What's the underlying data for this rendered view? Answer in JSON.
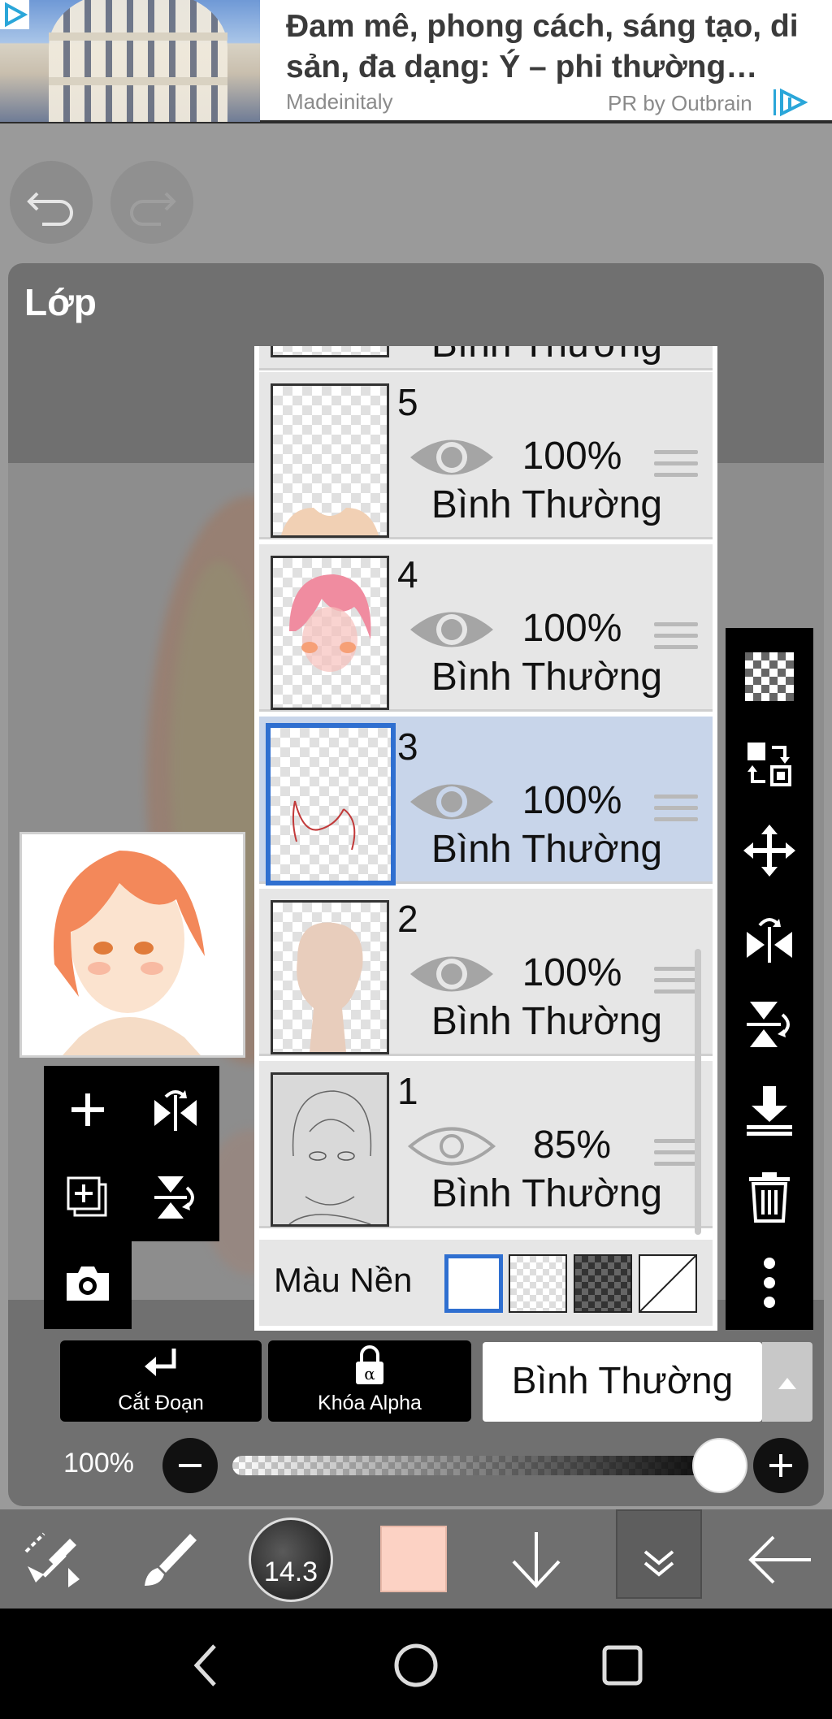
{
  "ad": {
    "title": "Đam mê, phong cách, sáng tạo, di sản, đa dạng: Ý – phi thường…",
    "source": "Madeinitaly",
    "pr": "PR by Outbrain"
  },
  "panel": {
    "title": "Lớp"
  },
  "layers": [
    {
      "number": "5",
      "opacity": "100%",
      "blend": "Bình Thường",
      "visible": true,
      "selected": false
    },
    {
      "number": "4",
      "opacity": "100%",
      "blend": "Bình Thường",
      "visible": true,
      "selected": false
    },
    {
      "number": "3",
      "opacity": "100%",
      "blend": "Bình Thường",
      "visible": true,
      "selected": true
    },
    {
      "number": "2",
      "opacity": "100%",
      "blend": "Bình Thường",
      "visible": true,
      "selected": false
    },
    {
      "number": "1",
      "opacity": "85%",
      "blend": "Bình Thường",
      "visible": true,
      "selected": false
    }
  ],
  "partial_layer_blend": "Bình Thường",
  "background": {
    "label": "Màu Nền",
    "options": [
      "white",
      "transparent",
      "dark-checker",
      "none"
    ],
    "selected": "white"
  },
  "controls": {
    "clip_label": "Cắt Đoạn",
    "alpha_lock_label": "Khóa Alpha",
    "blend_mode": "Bình Thường",
    "opacity_label": "100%",
    "opacity_value": 1.0
  },
  "bottom_toolbar": {
    "brush_size": "14.3",
    "current_color": "#fcd2c4"
  },
  "colors": {
    "selection": "#2f6fd0",
    "selected_row": "#c8d5ea"
  }
}
